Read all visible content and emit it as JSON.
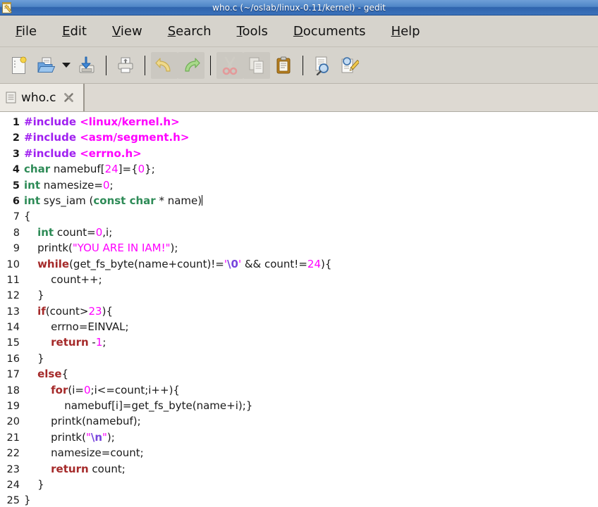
{
  "window": {
    "title": "who.c (~/oslab/linux-0.11/kernel) - gedit",
    "app_icon": "gedit-icon",
    "titlebar_color": "#4f86c6",
    "chrome_color": "#d6d3cc"
  },
  "menubar": {
    "items": [
      {
        "name": "file",
        "mnemonic": "F",
        "rest": "ile"
      },
      {
        "name": "edit",
        "mnemonic": "E",
        "rest": "dit"
      },
      {
        "name": "view",
        "mnemonic": "V",
        "rest": "iew"
      },
      {
        "name": "search",
        "mnemonic": "S",
        "rest": "earch"
      },
      {
        "name": "tools",
        "mnemonic": "T",
        "rest": "ools"
      },
      {
        "name": "documents",
        "mnemonic": "D",
        "rest": "ocuments"
      },
      {
        "name": "help",
        "mnemonic": "H",
        "rest": "elp"
      }
    ]
  },
  "toolbar": {
    "buttons": [
      {
        "name": "new-document-button",
        "icon": "new-document-icon",
        "enabled": true
      },
      {
        "name": "open-document-button",
        "icon": "open-folder-icon",
        "enabled": true
      },
      {
        "name": "open-dropdown-button",
        "icon": "chevron-down-icon",
        "enabled": true
      },
      {
        "name": "save-button",
        "icon": "save-disk-icon",
        "enabled": true
      },
      {
        "name": "print-button",
        "icon": "printer-icon",
        "enabled": true
      },
      {
        "name": "undo-button",
        "icon": "undo-arrow-icon",
        "enabled": false
      },
      {
        "name": "redo-button",
        "icon": "redo-arrow-icon",
        "enabled": false
      },
      {
        "name": "cut-button",
        "icon": "scissors-icon",
        "enabled": false
      },
      {
        "name": "copy-button",
        "icon": "copy-pages-icon",
        "enabled": false
      },
      {
        "name": "paste-button",
        "icon": "clipboard-icon",
        "enabled": true
      },
      {
        "name": "find-button",
        "icon": "find-magnifier-icon",
        "enabled": true
      },
      {
        "name": "replace-button",
        "icon": "replace-pencil-icon",
        "enabled": true
      }
    ]
  },
  "tabs": [
    {
      "name": "tab-who-c",
      "label": "who.c",
      "icon": "document-icon",
      "close_icon": "close-icon",
      "active": true
    }
  ],
  "editor": {
    "language": "c",
    "cursor_line": 6,
    "colors": {
      "preprocessor": "#a020f0",
      "include_path": "#ff00ff",
      "type_keyword": "#2e8b57",
      "control_keyword": "#a52a2a",
      "number": "#ff00ff",
      "string": "#ff00ff",
      "escape": "#7744dd",
      "text": "#1a1a1a",
      "background": "#ffffff"
    },
    "lines": [
      {
        "n": "1",
        "tokens": [
          {
            "t": "#include ",
            "c": "t-pp"
          },
          {
            "t": "<linux/kernel.h>",
            "c": "t-inc"
          }
        ]
      },
      {
        "n": "2",
        "tokens": [
          {
            "t": "#include ",
            "c": "t-pp"
          },
          {
            "t": "<asm/segment.h>",
            "c": "t-inc"
          }
        ]
      },
      {
        "n": "3",
        "tokens": [
          {
            "t": "#include ",
            "c": "t-pp"
          },
          {
            "t": "<errno.h>",
            "c": "t-inc"
          }
        ]
      },
      {
        "n": "4",
        "tokens": [
          {
            "t": "char",
            "c": "t-type"
          },
          {
            "t": " namebuf[",
            "c": "t-id"
          },
          {
            "t": "24",
            "c": "t-num"
          },
          {
            "t": "]={",
            "c": "t-id"
          },
          {
            "t": "0",
            "c": "t-num"
          },
          {
            "t": "};",
            "c": "t-id"
          }
        ]
      },
      {
        "n": "5",
        "tokens": [
          {
            "t": "int",
            "c": "t-type"
          },
          {
            "t": " namesize=",
            "c": "t-id"
          },
          {
            "t": "0",
            "c": "t-num"
          },
          {
            "t": ";",
            "c": "t-id"
          }
        ]
      },
      {
        "n": "6",
        "tokens": [
          {
            "t": "int",
            "c": "t-type"
          },
          {
            "t": " sys_iam (",
            "c": "t-id"
          },
          {
            "t": "const char",
            "c": "t-type"
          },
          {
            "t": " * name)",
            "c": "t-id"
          }
        ],
        "cursor": true
      },
      {
        "n": "7",
        "tokens": [
          {
            "t": "{",
            "c": "t-id"
          }
        ]
      },
      {
        "n": "8",
        "tokens": [
          {
            "t": "    ",
            "c": "t-id"
          },
          {
            "t": "int",
            "c": "t-type"
          },
          {
            "t": " count=",
            "c": "t-id"
          },
          {
            "t": "0",
            "c": "t-num"
          },
          {
            "t": ",i;",
            "c": "t-id"
          }
        ]
      },
      {
        "n": "9",
        "tokens": [
          {
            "t": "    printk(",
            "c": "t-id"
          },
          {
            "t": "\"YOU ARE IN IAM!\"",
            "c": "t-str"
          },
          {
            "t": ");",
            "c": "t-id"
          }
        ]
      },
      {
        "n": "10",
        "tokens": [
          {
            "t": "    ",
            "c": "t-id"
          },
          {
            "t": "while",
            "c": "t-kw"
          },
          {
            "t": "(get_fs_byte(name+count)!=",
            "c": "t-id"
          },
          {
            "t": "'",
            "c": "t-str"
          },
          {
            "t": "\\0",
            "c": "t-esc"
          },
          {
            "t": "'",
            "c": "t-str"
          },
          {
            "t": " && count!=",
            "c": "t-id"
          },
          {
            "t": "24",
            "c": "t-num"
          },
          {
            "t": "){",
            "c": "t-id"
          }
        ]
      },
      {
        "n": "11",
        "tokens": [
          {
            "t": "        count++;",
            "c": "t-id"
          }
        ]
      },
      {
        "n": "12",
        "tokens": [
          {
            "t": "    }",
            "c": "t-id"
          }
        ]
      },
      {
        "n": "13",
        "tokens": [
          {
            "t": "    ",
            "c": "t-id"
          },
          {
            "t": "if",
            "c": "t-kw"
          },
          {
            "t": "(count>",
            "c": "t-id"
          },
          {
            "t": "23",
            "c": "t-num"
          },
          {
            "t": "){",
            "c": "t-id"
          }
        ]
      },
      {
        "n": "14",
        "tokens": [
          {
            "t": "        errno=EINVAL;",
            "c": "t-id"
          }
        ]
      },
      {
        "n": "15",
        "tokens": [
          {
            "t": "        ",
            "c": "t-id"
          },
          {
            "t": "return",
            "c": "t-kw"
          },
          {
            "t": " -",
            "c": "t-id"
          },
          {
            "t": "1",
            "c": "t-num"
          },
          {
            "t": ";",
            "c": "t-id"
          }
        ]
      },
      {
        "n": "16",
        "tokens": [
          {
            "t": "    }",
            "c": "t-id"
          }
        ]
      },
      {
        "n": "17",
        "tokens": [
          {
            "t": "    ",
            "c": "t-id"
          },
          {
            "t": "else",
            "c": "t-kw"
          },
          {
            "t": "{",
            "c": "t-id"
          }
        ]
      },
      {
        "n": "18",
        "tokens": [
          {
            "t": "        ",
            "c": "t-id"
          },
          {
            "t": "for",
            "c": "t-kw"
          },
          {
            "t": "(i=",
            "c": "t-id"
          },
          {
            "t": "0",
            "c": "t-num"
          },
          {
            "t": ";i<=count;i++){",
            "c": "t-id"
          }
        ]
      },
      {
        "n": "19",
        "tokens": [
          {
            "t": "            namebuf[i]=get_fs_byte(name+i);}",
            "c": "t-id"
          }
        ]
      },
      {
        "n": "20",
        "tokens": [
          {
            "t": "        printk(namebuf);",
            "c": "t-id"
          }
        ]
      },
      {
        "n": "21",
        "tokens": [
          {
            "t": "        printk(",
            "c": "t-id"
          },
          {
            "t": "\"",
            "c": "t-str"
          },
          {
            "t": "\\n",
            "c": "t-esc"
          },
          {
            "t": "\"",
            "c": "t-str"
          },
          {
            "t": ");",
            "c": "t-id"
          }
        ]
      },
      {
        "n": "22",
        "tokens": [
          {
            "t": "        namesize=count;",
            "c": "t-id"
          }
        ]
      },
      {
        "n": "23",
        "tokens": [
          {
            "t": "        ",
            "c": "t-id"
          },
          {
            "t": "return",
            "c": "t-kw"
          },
          {
            "t": " count;",
            "c": "t-id"
          }
        ]
      },
      {
        "n": "24",
        "tokens": [
          {
            "t": "    }",
            "c": "t-id"
          }
        ]
      },
      {
        "n": "25",
        "tokens": [
          {
            "t": "}",
            "c": "t-id"
          }
        ]
      }
    ]
  }
}
